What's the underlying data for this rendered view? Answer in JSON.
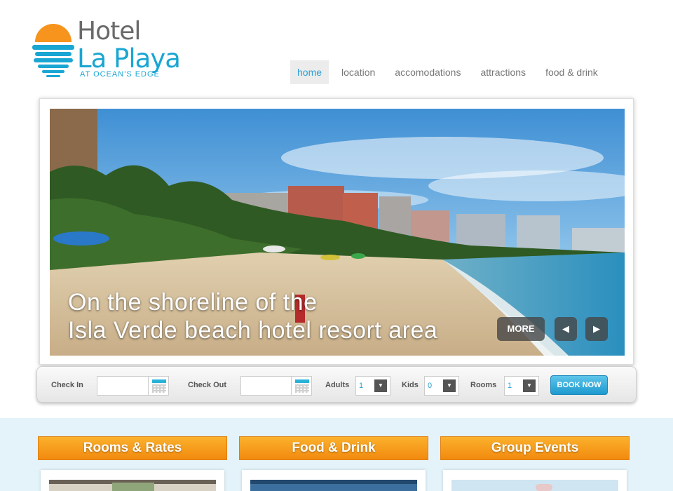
{
  "brand": {
    "title_line1": "Hotel",
    "title_line2": "La Playa",
    "tagline": "AT OCEAN'S EDGE",
    "sun_color": "#f7941d",
    "water_color": "#1aa6d3"
  },
  "nav": {
    "items": [
      {
        "label": "home",
        "active": true
      },
      {
        "label": "location",
        "active": false
      },
      {
        "label": "accomodations",
        "active": false
      },
      {
        "label": "attractions",
        "active": false
      },
      {
        "label": "food & drink",
        "active": false
      }
    ]
  },
  "slider": {
    "caption_line1": "On the shoreline of the",
    "caption_line2": "Isla Verde beach hotel resort area",
    "more_label": "MORE",
    "prev_icon": "◀",
    "next_icon": "▶"
  },
  "booking": {
    "check_in_label": "Check In",
    "check_in_value": "",
    "check_out_label": "Check Out",
    "check_out_value": "",
    "adults_label": "Adults",
    "adults_value": "1",
    "kids_label": "Kids",
    "kids_value": "0",
    "rooms_label": "Rooms",
    "rooms_value": "1",
    "book_label": "BOOK NOW"
  },
  "cards": [
    {
      "title": "Rooms & Rates"
    },
    {
      "title": "Food & Drink"
    },
    {
      "title": "Group Events"
    }
  ],
  "colors": {
    "accent": "#2aa0d4",
    "card_orange": "#f7941d",
    "band": "#e3f3f9"
  }
}
